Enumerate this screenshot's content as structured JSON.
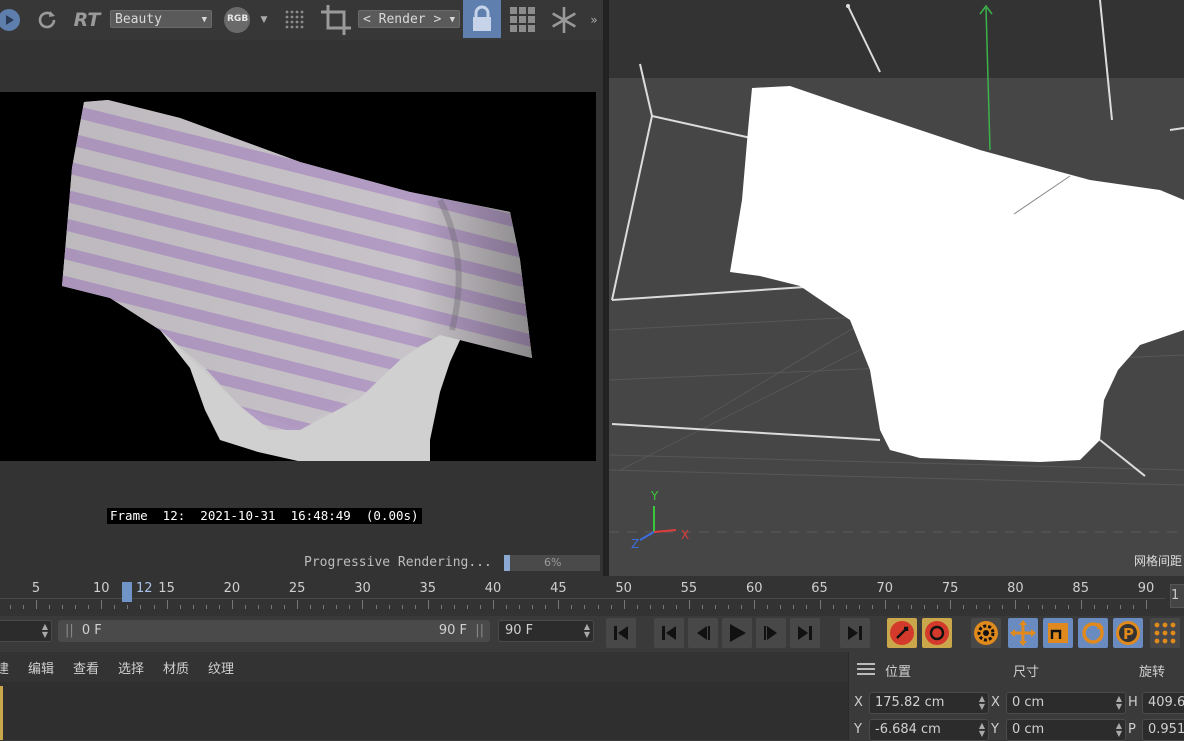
{
  "render_toolbar": {
    "pass_dropdown": "Beauty",
    "channel_badge": "RGB",
    "render_dropdown": "< Render >",
    "more": "»"
  },
  "render_view": {
    "frame_label": "Frame  12:  2021-10-31  16:48:49  (0.00s)",
    "progress_text": "Progressive Rendering...",
    "progress_percent": "6%",
    "progress_fraction": 0.06
  },
  "viewport": {
    "grid_spacing_label": "网格间距",
    "axis_y": "Y",
    "axis_x": "X",
    "axis_z": "Z"
  },
  "timeline": {
    "ticks": [
      "5",
      "10",
      "15",
      "20",
      "25",
      "30",
      "35",
      "40",
      "45",
      "50",
      "55",
      "60",
      "65",
      "70",
      "75",
      "80",
      "85",
      "90"
    ],
    "current_frame": "12",
    "end_box": "1"
  },
  "transport": {
    "start_field": "0 F",
    "range_end": "90 F",
    "end_field": "90 F"
  },
  "menu": {
    "items": [
      "建",
      "编辑",
      "查看",
      "选择",
      "材质",
      "纹理"
    ]
  },
  "coordinates": {
    "headers": [
      "位置",
      "尺寸",
      "旋转"
    ],
    "rows": [
      {
        "axis": "X",
        "position": "175.82 cm",
        "size_axis": "X",
        "size": "0 cm",
        "rot_axis": "H",
        "rotation": "409.6"
      },
      {
        "axis": "Y",
        "position": "-6.684 cm",
        "size_axis": "Y",
        "size": "0 cm",
        "rot_axis": "P",
        "rotation": "0.951"
      }
    ]
  },
  "colors": {
    "accent": "#7094c8",
    "axis_x": "#e03c3c",
    "axis_y": "#3cc83c",
    "axis_z": "#3c6ee0"
  }
}
